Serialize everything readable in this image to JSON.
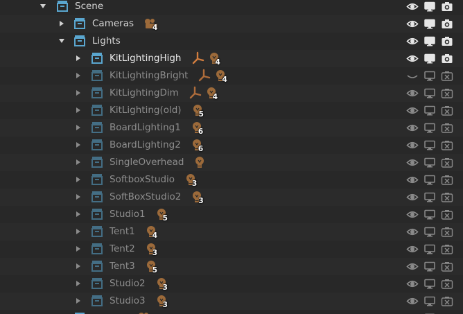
{
  "outliner": {
    "rows": [
      {
        "label": "Scene",
        "depth": 0,
        "state": "normal",
        "has_toggle": true,
        "expanded": true,
        "icons": [],
        "visibility": "on"
      },
      {
        "label": "Cameras",
        "depth": 1,
        "state": "normal",
        "has_toggle": true,
        "expanded": false,
        "icons": [
          {
            "type": "camera",
            "count": "4"
          }
        ],
        "visibility": "on"
      },
      {
        "label": "Lights",
        "depth": 1,
        "state": "normal",
        "has_toggle": true,
        "expanded": true,
        "icons": [],
        "visibility": "on"
      },
      {
        "label": "KitLightingHigh",
        "depth": 2,
        "state": "active",
        "has_toggle": true,
        "expanded": false,
        "icons": [
          {
            "type": "empty"
          },
          {
            "type": "light",
            "count": "4"
          }
        ],
        "visibility": "on"
      },
      {
        "label": "KitLightingBright",
        "depth": 2,
        "state": "dim",
        "has_toggle": true,
        "expanded": false,
        "icons": [
          {
            "type": "empty"
          },
          {
            "type": "light",
            "count": "4"
          }
        ],
        "visibility": "hidden"
      },
      {
        "label": "KitLightingDim",
        "depth": 2,
        "state": "dim",
        "has_toggle": true,
        "expanded": false,
        "icons": [
          {
            "type": "empty"
          },
          {
            "type": "light",
            "count": "4"
          }
        ],
        "visibility": "off"
      },
      {
        "label": "KitLighting(old)",
        "depth": 2,
        "state": "dim",
        "has_toggle": true,
        "expanded": false,
        "icons": [
          {
            "type": "light",
            "count": "5"
          }
        ],
        "visibility": "off"
      },
      {
        "label": "BoardLighting1",
        "depth": 2,
        "state": "dim",
        "has_toggle": true,
        "expanded": false,
        "icons": [
          {
            "type": "light",
            "count": "6"
          }
        ],
        "visibility": "off"
      },
      {
        "label": "BoardLighting2",
        "depth": 2,
        "state": "dim",
        "has_toggle": true,
        "expanded": false,
        "icons": [
          {
            "type": "light",
            "count": "6"
          }
        ],
        "visibility": "off"
      },
      {
        "label": "SingleOverhead",
        "depth": 2,
        "state": "dim",
        "has_toggle": true,
        "expanded": false,
        "icons": [
          {
            "type": "light",
            "count": ""
          }
        ],
        "visibility": "off"
      },
      {
        "label": "SoftboxStudio",
        "depth": 2,
        "state": "dim",
        "has_toggle": true,
        "expanded": false,
        "icons": [
          {
            "type": "light",
            "count": "3"
          }
        ],
        "visibility": "off"
      },
      {
        "label": "SoftBoxStudio2",
        "depth": 2,
        "state": "dim",
        "has_toggle": true,
        "expanded": false,
        "icons": [
          {
            "type": "light",
            "count": "3"
          }
        ],
        "visibility": "off"
      },
      {
        "label": "Studio1",
        "depth": 2,
        "state": "dim",
        "has_toggle": true,
        "expanded": false,
        "icons": [
          {
            "type": "light",
            "count": "5"
          }
        ],
        "visibility": "off"
      },
      {
        "label": "Tent1",
        "depth": 2,
        "state": "dim",
        "has_toggle": true,
        "expanded": false,
        "icons": [
          {
            "type": "light",
            "count": "4"
          }
        ],
        "visibility": "off"
      },
      {
        "label": "Tent2",
        "depth": 2,
        "state": "dim",
        "has_toggle": true,
        "expanded": false,
        "icons": [
          {
            "type": "light",
            "count": "3"
          }
        ],
        "visibility": "off"
      },
      {
        "label": "Tent3",
        "depth": 2,
        "state": "dim",
        "has_toggle": true,
        "expanded": false,
        "icons": [
          {
            "type": "light",
            "count": "5"
          }
        ],
        "visibility": "off"
      },
      {
        "label": "Studio2",
        "depth": 2,
        "state": "dim",
        "has_toggle": true,
        "expanded": false,
        "icons": [
          {
            "type": "light",
            "count": "3"
          }
        ],
        "visibility": "off"
      },
      {
        "label": "Studio3",
        "depth": 2,
        "state": "dim",
        "has_toggle": true,
        "expanded": false,
        "icons": [
          {
            "type": "light",
            "count": "3"
          }
        ],
        "visibility": "off"
      }
    ]
  },
  "colors": {
    "collection_icon": "#5aa6cf",
    "object_icon": "#d17d3f",
    "data_icon": "#9c6a3a",
    "tree_line": "#4a89b0",
    "toggle_on": "#e6e6e6",
    "toggle_off": "#8a8a8a"
  }
}
